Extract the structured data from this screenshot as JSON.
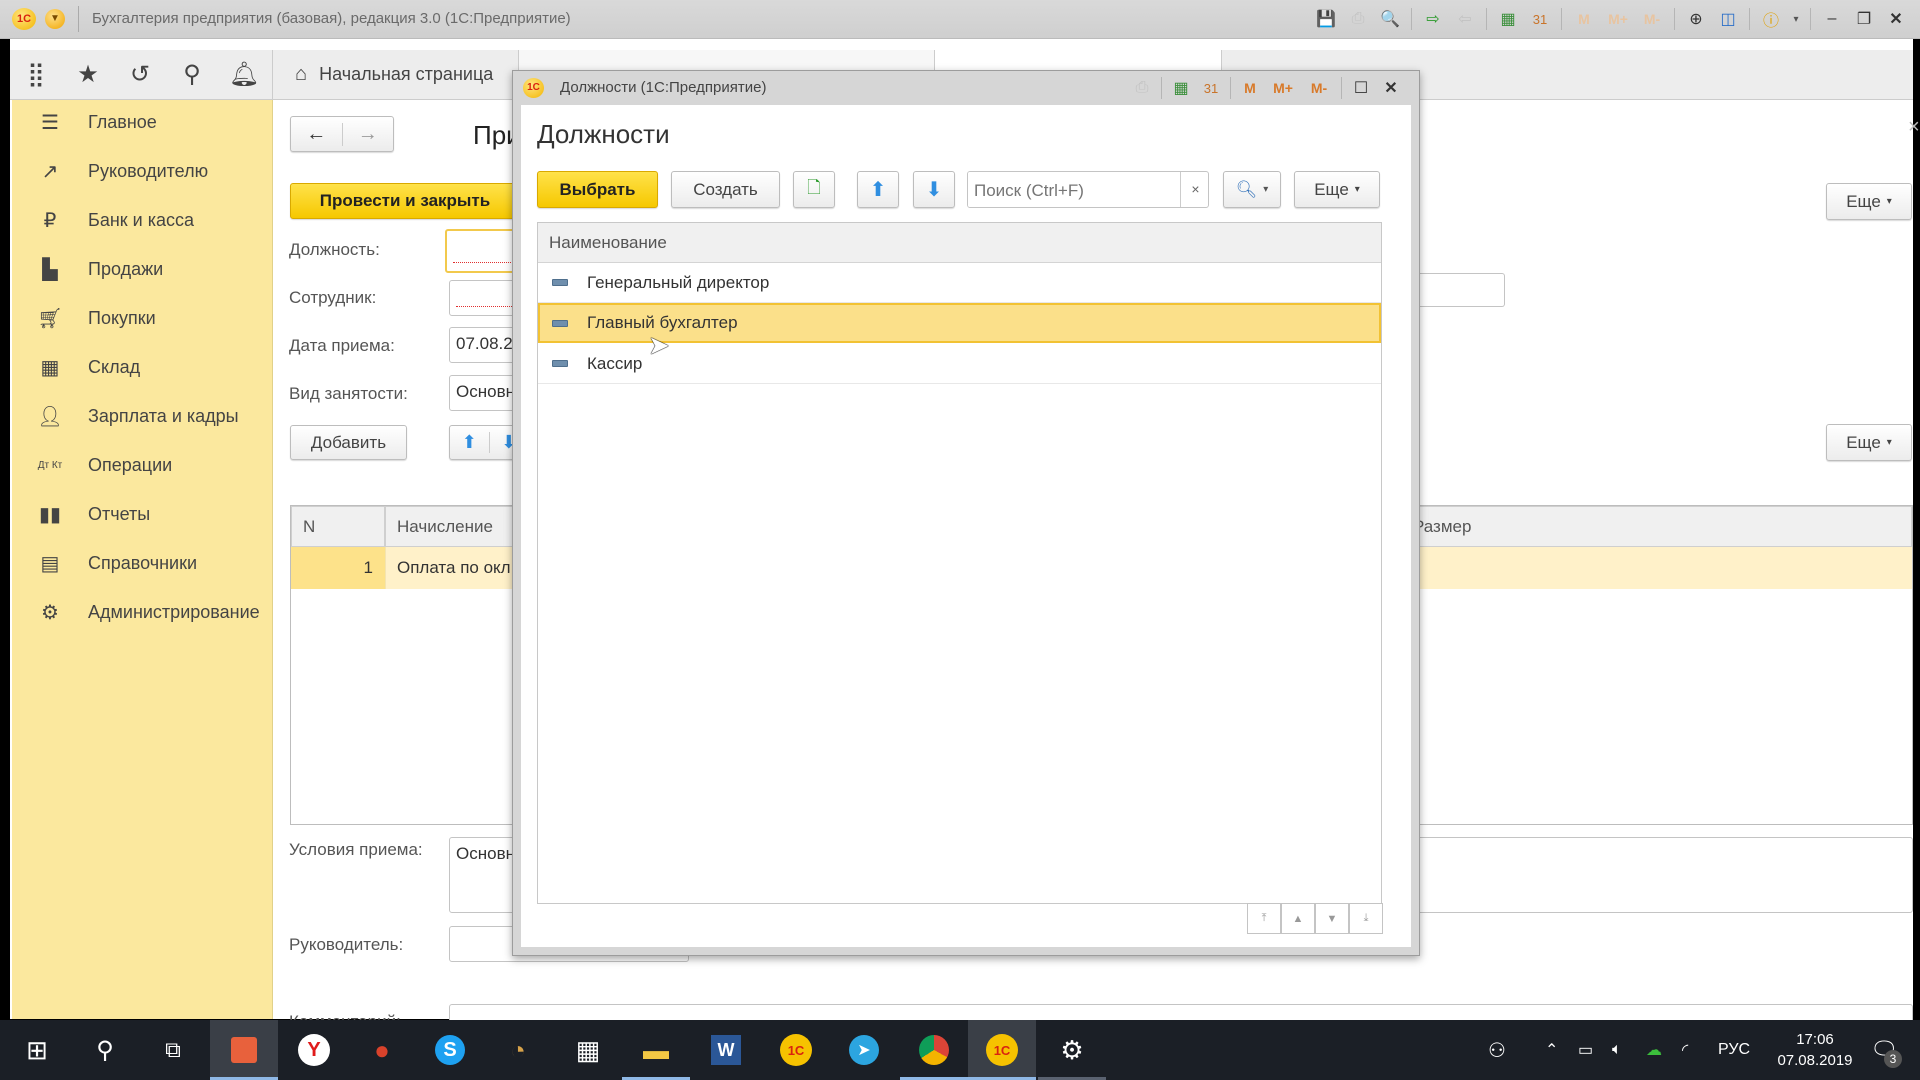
{
  "window": {
    "title": "Бухгалтерия предприятия (базовая), редакция 3.0  (1С:Предприятие)",
    "logo_text": "1С",
    "toolbar_icons": [
      "save-icon",
      "print-icon",
      "preview-icon",
      "link-import-icon",
      "link-export-icon",
      "calculator-icon",
      "calendar-icon",
      "memory-m",
      "memory-m-plus",
      "memory-m-minus",
      "zoom-in-icon",
      "panels-icon",
      "info-icon",
      "minimize-icon",
      "restore-icon",
      "close-icon"
    ],
    "memory_labels": [
      "M",
      "M+",
      "M-"
    ]
  },
  "topnav": {
    "icons": [
      "apps-grid-icon",
      "star-icon",
      "history-icon",
      "search-icon",
      "bell-icon"
    ],
    "home_tab": "Начальная страница"
  },
  "sidebar": {
    "items": [
      {
        "label": "Главное",
        "icon": "menu-lines-icon",
        "glyph": "☰"
      },
      {
        "label": "Руководителю",
        "icon": "trend-icon",
        "glyph": "↗"
      },
      {
        "label": "Банк и касса",
        "icon": "ruble-icon",
        "glyph": "₽"
      },
      {
        "label": "Продажи",
        "icon": "bag-icon",
        "glyph": "🛍"
      },
      {
        "label": "Покупки",
        "icon": "cart-icon",
        "glyph": "🛒"
      },
      {
        "label": "Склад",
        "icon": "warehouse-icon",
        "glyph": "▦"
      },
      {
        "label": "Зарплата и кадры",
        "icon": "person-icon",
        "glyph": "👤"
      },
      {
        "label": "Операции",
        "icon": "dt-kt-icon",
        "glyph": "ДтКт"
      },
      {
        "label": "Отчеты",
        "icon": "bar-chart-icon",
        "glyph": "📊"
      },
      {
        "label": "Справочники",
        "icon": "books-icon",
        "glyph": "▤"
      },
      {
        "label": "Администрирование",
        "icon": "gear-icon",
        "glyph": "⚙"
      }
    ]
  },
  "form": {
    "title_fragment": "При",
    "post_close_button": "Провести и закрыть",
    "more_button": "Еще",
    "fields": {
      "position_label": "Должность:",
      "position_value": "",
      "employee_label": "Сотрудник:",
      "employee_value": "",
      "hire_date_label": "Дата приема:",
      "hire_date_value": "07.08.20",
      "employment_type_label": "Вид занятости:",
      "employment_type_value": "Основно",
      "conditions_label": "Условия приема:",
      "conditions_value": "Основно",
      "manager_label": "Руководитель:",
      "manager_value": "",
      "comment_label": "Комментарий:",
      "comment_value": ""
    },
    "add_button": "Добавить",
    "accruals_table": {
      "columns": [
        "N",
        "Начисление",
        "Размер"
      ],
      "rows": [
        {
          "n": "1",
          "accrual": "Оплата по окл",
          "size": ""
        }
      ]
    }
  },
  "dialog": {
    "window_title": "Должности  (1С:Предприятие)",
    "heading": "Должности",
    "select_button": "Выбрать",
    "create_button": "Создать",
    "search_placeholder": "Поиск (Ctrl+F)",
    "search_clear": "×",
    "more_button": "Еще",
    "list": {
      "column": "Наименование",
      "rows": [
        {
          "name": "Генеральный директор",
          "selected": false
        },
        {
          "name": "Главный бухгалтер",
          "selected": true
        },
        {
          "name": "Кассир",
          "selected": false
        }
      ]
    },
    "memory_labels": [
      "M",
      "M+",
      "M-"
    ]
  },
  "taskbar": {
    "apps": [
      "start-icon",
      "search-icon",
      "task-view-icon",
      "presentation-app-icon",
      "yandex-browser-icon",
      "apple-app-icon",
      "skype-icon",
      "clock-app-icon",
      "calculator-icon",
      "file-explorer-icon",
      "word-icon",
      "1c-icon",
      "telegram-icon",
      "chrome-icon",
      "1c-active-icon",
      "settings-icon"
    ],
    "language": "РУС",
    "time": "17:06",
    "date": "07.08.2019",
    "notifications_count": "3"
  },
  "colors": {
    "accent_yellow": "#f6c800",
    "sidebar_bg": "#fbe89e",
    "selected_row": "#fbe08a",
    "taskbar_bg": "#1b1f26"
  }
}
